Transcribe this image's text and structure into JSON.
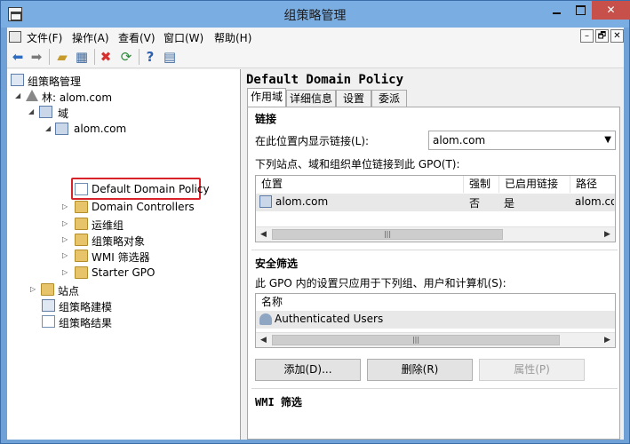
{
  "window": {
    "title": "组策略管理",
    "minimize": "",
    "maximize": "",
    "close": "✕"
  },
  "menu": {
    "items": [
      "文件(F)",
      "操作(A)",
      "查看(V)",
      "窗口(W)",
      "帮助(H)"
    ],
    "mdi": [
      "–",
      "🗗",
      "✕"
    ]
  },
  "toolbar": {
    "icons": [
      "back-arrow-icon",
      "forward-arrow-icon",
      "folder-up-icon",
      "show-pane-icon",
      "delete-icon",
      "refresh-icon",
      "help-icon",
      "properties-icon"
    ]
  },
  "tree": {
    "root": "组策略管理",
    "forest": "林: alom.com",
    "domains": "域",
    "domain": "alom.com",
    "selected": "Default Domain Policy",
    "children": [
      "Domain Controllers",
      "运维组",
      "组策略对象",
      "WMI 筛选器",
      "Starter GPO"
    ],
    "sites": "站点",
    "modeling": "组策略建模",
    "results": "组策略结果"
  },
  "details": {
    "title": "Default Domain Policy",
    "tabs": [
      "作用域",
      "详细信息",
      "设置",
      "委派"
    ],
    "links": {
      "heading": "链接",
      "location_label": "在此位置内显示链接(L):",
      "location_value": "alom.com",
      "list_label": "下列站点、域和组织单位链接到此 GPO(T):",
      "columns": [
        "位置",
        "强制",
        "已启用链接",
        "路径"
      ],
      "rows": [
        {
          "location": "alom.com",
          "enforced": "否",
          "enabled": "是",
          "path": "alom.com"
        }
      ]
    },
    "security": {
      "heading": "安全筛选",
      "label": "此 GPO 内的设置只应用于下列组、用户和计算机(S):",
      "column": "名称",
      "rows": [
        "Authenticated Users"
      ],
      "buttons": {
        "add": "添加(D)...",
        "remove": "删除(R)",
        "properties": "属性(P)"
      }
    },
    "wmi": {
      "heading": "WMI 筛选"
    }
  }
}
